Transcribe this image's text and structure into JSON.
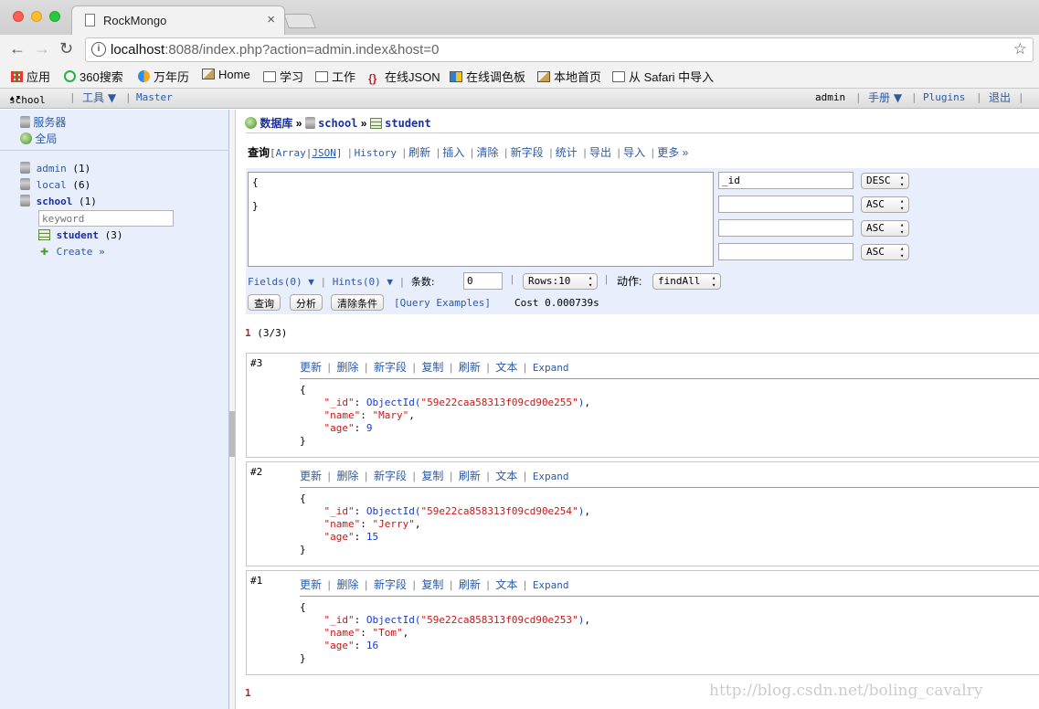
{
  "browser": {
    "tab_title": "RockMongo",
    "tab_close": "×",
    "url_host": "localhost",
    "url_rest": ":8088/index.php?action=admin.index&host=0",
    "bookmarks": [
      "应用",
      "360搜索",
      "万年历",
      "Home",
      "学习",
      "工作",
      "在线JSON",
      "在线调色板",
      "本地首页",
      "从 Safari 中导入"
    ]
  },
  "topbar": {
    "db_select": "school",
    "tools": "工具 ▼",
    "master": "Master",
    "user": "admin",
    "manual": "手册 ▼",
    "plugins": "Plugins",
    "logout": "退出"
  },
  "sidebar": {
    "server": "服务器",
    "global": "全局",
    "dbs": [
      {
        "name": "admin",
        "count": "(1)"
      },
      {
        "name": "local",
        "count": "(6)"
      },
      {
        "name": "school",
        "count": "(1)"
      }
    ],
    "keyword_placeholder": "keyword",
    "collection": {
      "name": "student",
      "count": "(3)"
    },
    "create": "Create »"
  },
  "breadcrumb": {
    "db": "数据库",
    "sep": "»",
    "dbname": "school",
    "collection": "student"
  },
  "toolbar": {
    "query": "查询",
    "array": "Array",
    "json": "JSON",
    "items": [
      "History",
      "刷新",
      "插入",
      "清除",
      "新字段",
      "统计",
      "导出",
      "导入",
      "更多 »"
    ]
  },
  "query": {
    "text": "{\n\n}",
    "sort_fields": [
      "_id",
      "",
      "",
      ""
    ],
    "sort_orders": [
      "DESC",
      "ASC",
      "ASC",
      "ASC"
    ],
    "fields": "Fields(0) ▼",
    "hints": "Hints(0) ▼",
    "limit_label": "条数:",
    "limit_value": "0",
    "rows": "Rows:10",
    "action_label": "动作:",
    "action": "findAll",
    "btn_query": "查询",
    "btn_explain": "分析",
    "btn_clear": "清除条件",
    "examples": "[Query Examples]",
    "cost": "Cost 0.000739s"
  },
  "pagination": {
    "page": "1",
    "info": "(3/3)",
    "bottom": "1"
  },
  "record_ops": [
    "更新",
    "删除",
    "新字段",
    "复制",
    "刷新",
    "文本",
    "Expand"
  ],
  "records": [
    {
      "num": "#3",
      "id": "59e22caa58313f09cd90e255",
      "name": "\"Mary\"",
      "age": "9"
    },
    {
      "num": "#2",
      "id": "59e22ca858313f09cd90e254",
      "name": "\"Jerry\"",
      "age": "15"
    },
    {
      "num": "#1",
      "id": "59e22ca858313f09cd90e253",
      "name": "\"Tom\"",
      "age": "16"
    }
  ],
  "watermark": "http://blog.csdn.net/boling_cavalry"
}
